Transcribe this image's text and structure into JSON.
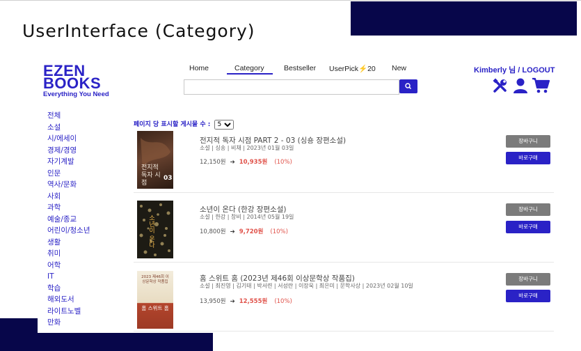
{
  "slide": {
    "title": "UserInterface (Category)"
  },
  "logo": {
    "line1": "EZEN",
    "line2": "BOOKS",
    "tagline": "Everything You Need"
  },
  "nav": [
    {
      "label": "Home"
    },
    {
      "label": "Category"
    },
    {
      "label": "Bestseller"
    },
    {
      "label": "UserPick⚡20"
    },
    {
      "label": "New"
    }
  ],
  "search": {
    "value": "",
    "placeholder": ""
  },
  "user": {
    "label": "Kimberly 님 / LOGOUT"
  },
  "icons": [
    "tools-icon",
    "user-icon",
    "cart-icon"
  ],
  "sidebar": {
    "categories": [
      "전체",
      "소설",
      "시/에세이",
      "경제/경영",
      "자기계발",
      "인문",
      "역사/문화",
      "사회",
      "과학",
      "예술/종교",
      "어린이/청소년",
      "생활",
      "취미",
      "어학",
      "IT",
      "학습",
      "해외도서",
      "라이트노벨",
      "만화"
    ]
  },
  "per_page": {
    "label": "페이지 당 표시할 게시물 수 :",
    "selected": "5"
  },
  "books": [
    {
      "title": "전지적 독자 시점 PART 2 - 03 (싱숑 장편소설)",
      "meta": "소설 | 싱숑 | 비채 | 2023년 01월 03일",
      "price": "12,150원",
      "sale_price": "10,935원",
      "discount": "(10%)",
      "cart_label": "장바구니",
      "buy_label": "바로구매",
      "cover_text": "전지적 독자 시점",
      "cover_num": "03"
    },
    {
      "title": "소년이 온다 (한강 장편소설)",
      "meta": "소설 | 한강 | 창비 | 2014년 05월 19일",
      "price": "10,800원",
      "sale_price": "9,720원",
      "discount": "(10%)",
      "cart_label": "장바구니",
      "buy_label": "바로구매",
      "cover_text": "소년이 온다"
    },
    {
      "title": "홈 스위트 홈 (2023년 제46회 이상문학상 작품집)",
      "meta": "소설 | 최진영 | 김기태 | 박서련 | 서성란 | 이장욱 | 최은미 | 문학사상 | 2023년 02월 10일",
      "price": "13,950원",
      "sale_price": "12,555원",
      "discount": "(10%)",
      "cart_label": "장바구니",
      "buy_label": "바로구매",
      "cover_text": "홈 스위트 홈",
      "cover_top": "2023 제46회 이상문학상 작품집"
    }
  ],
  "colors": {
    "brand": "#2a22c6",
    "dark_navy": "#07064a",
    "sale": "#e0524a",
    "cart_button": "#7b7b7b"
  }
}
